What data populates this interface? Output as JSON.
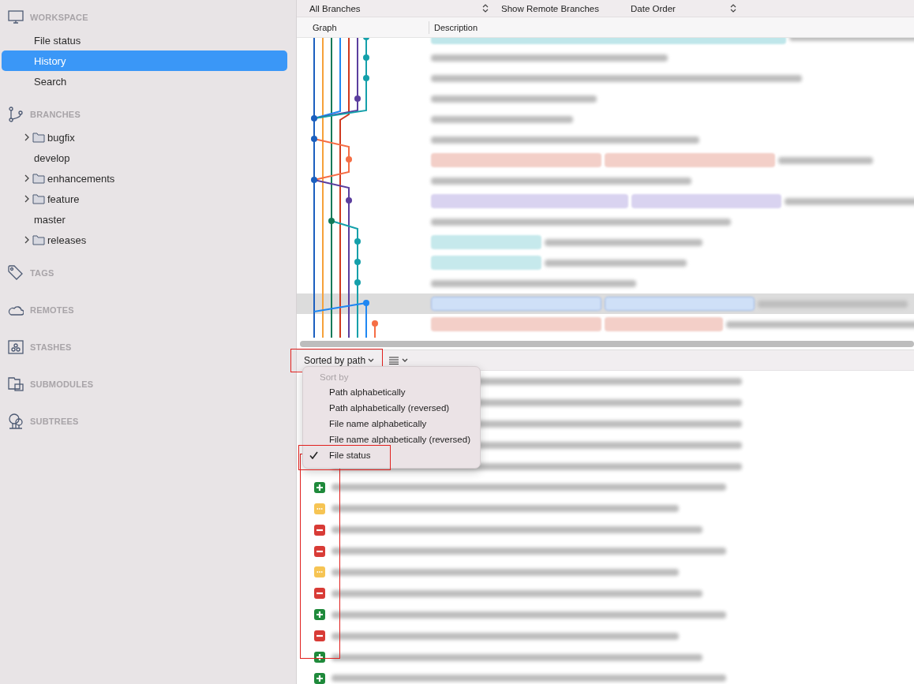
{
  "sidebar": {
    "sections": [
      {
        "title": "WORKSPACE",
        "kind": "workspace",
        "items": [
          {
            "label": "File status",
            "kind": "view",
            "selected": false
          },
          {
            "label": "History",
            "kind": "view",
            "selected": true
          },
          {
            "label": "Search",
            "kind": "view",
            "selected": false
          }
        ]
      },
      {
        "title": "BRANCHES",
        "kind": "branches",
        "items": [
          {
            "label": "bugfix",
            "kind": "folder",
            "expanded": false
          },
          {
            "label": "develop",
            "kind": "branch"
          },
          {
            "label": "enhancements",
            "kind": "folder",
            "expanded": false
          },
          {
            "label": "feature",
            "kind": "folder",
            "expanded": false
          },
          {
            "label": "master",
            "kind": "branch"
          },
          {
            "label": "releases",
            "kind": "folder",
            "expanded": false
          }
        ]
      },
      {
        "title": "TAGS",
        "kind": "tags"
      },
      {
        "title": "REMOTES",
        "kind": "remotes"
      },
      {
        "title": "STASHES",
        "kind": "stashes"
      },
      {
        "title": "SUBMODULES",
        "kind": "submodules"
      },
      {
        "title": "SUBTREES",
        "kind": "subtrees"
      }
    ]
  },
  "toolbar": {
    "branch_filter": "All Branches",
    "remote_toggle": "Show Remote Branches",
    "order": "Date Order"
  },
  "history": {
    "columns": [
      "Graph",
      "Description"
    ],
    "commits": [
      {
        "selected": false,
        "tags": [
          {
            "color": "#bfe6ea"
          }
        ]
      },
      {
        "selected": false
      },
      {
        "selected": false
      },
      {
        "selected": false
      },
      {
        "selected": false
      },
      {
        "selected": false
      },
      {
        "selected": false,
        "tags": [
          {
            "color": "#f3cfc8"
          },
          {
            "color": "#f3cfc8"
          }
        ]
      },
      {
        "selected": false
      },
      {
        "selected": false,
        "tags": [
          {
            "color": "#d9d3f0"
          },
          {
            "color": "#d9d3f0"
          }
        ]
      },
      {
        "selected": false
      },
      {
        "selected": false,
        "tags": [
          {
            "color": "#c6e9ec"
          }
        ]
      },
      {
        "selected": false,
        "tags": [
          {
            "color": "#c6e9ec"
          }
        ]
      },
      {
        "selected": false
      },
      {
        "selected": true,
        "tags": [
          {
            "color": "#cfe0f7"
          },
          {
            "color": "#cfe0f7"
          }
        ]
      },
      {
        "selected": false,
        "tags": [
          {
            "color": "#f3cfc8"
          },
          {
            "color": "#f3cfc8"
          }
        ]
      }
    ]
  },
  "files": {
    "sort_button": "Sorted by path",
    "sort_menu": {
      "header": "Sort by",
      "items": [
        {
          "label": "Path alphabetically",
          "selected": false
        },
        {
          "label": "Path alphabetically (reversed)",
          "selected": false
        },
        {
          "label": "File name alphabetically",
          "selected": false
        },
        {
          "label": "File name alphabetically (reversed)",
          "selected": false
        },
        {
          "label": "File status",
          "selected": true
        }
      ]
    },
    "rows": [
      {
        "kind": "covered"
      },
      {
        "kind": "covered"
      },
      {
        "kind": "covered"
      },
      {
        "kind": "covered"
      },
      {
        "kind": "covered"
      },
      {
        "kind": "added"
      },
      {
        "kind": "modified"
      },
      {
        "kind": "removed"
      },
      {
        "kind": "removed"
      },
      {
        "kind": "modified"
      },
      {
        "kind": "removed"
      },
      {
        "kind": "added"
      },
      {
        "kind": "removed"
      },
      {
        "kind": "added"
      },
      {
        "kind": "added"
      }
    ]
  },
  "highlights": {
    "sort_button": true,
    "selected_sort_item": true,
    "status_icons": true
  }
}
